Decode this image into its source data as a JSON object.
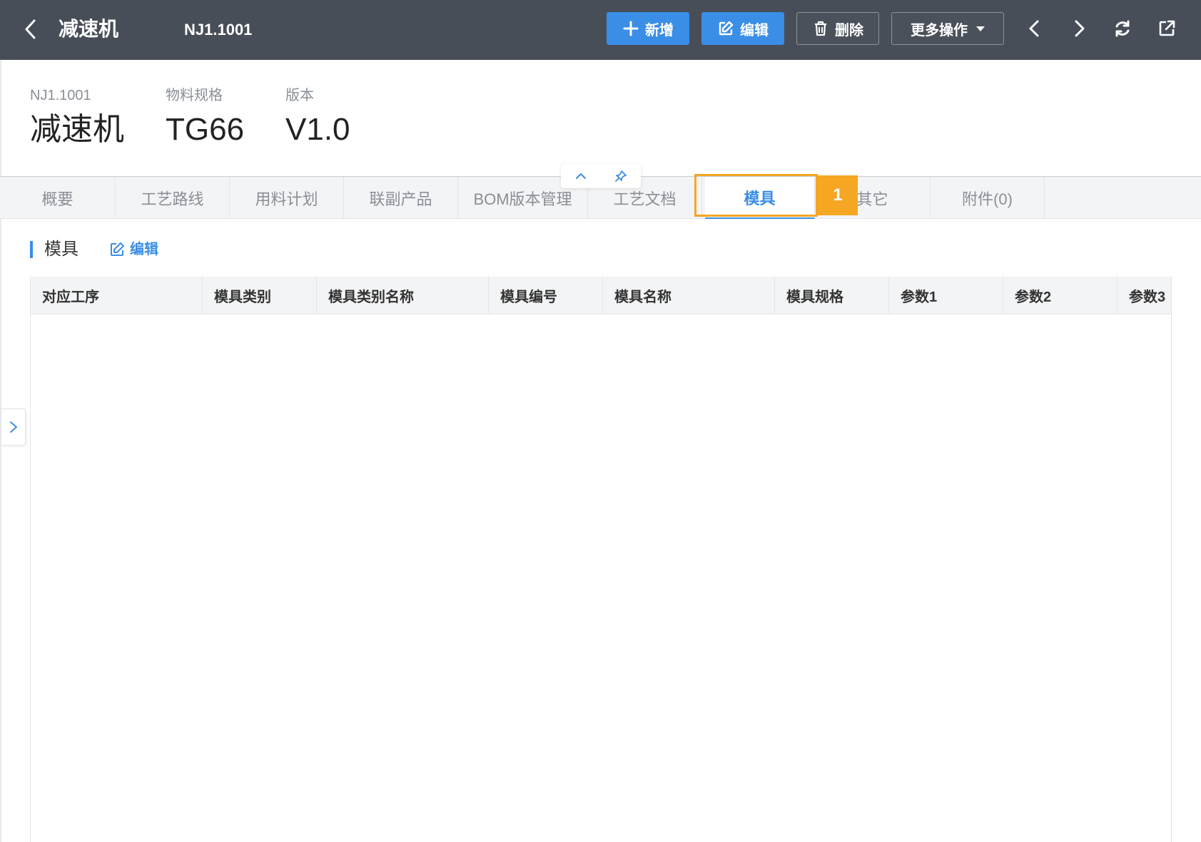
{
  "header": {
    "title": "减速机",
    "code": "NJ1.1001",
    "buttons": {
      "add": "新增",
      "edit": "编辑",
      "delete": "删除",
      "more": "更多操作"
    }
  },
  "info": [
    {
      "label": "NJ1.1001",
      "value": "减速机"
    },
    {
      "label": "物料规格",
      "value": "TG66"
    },
    {
      "label": "版本",
      "value": "V1.0"
    }
  ],
  "tabs": [
    {
      "label": "概要"
    },
    {
      "label": "工艺路线"
    },
    {
      "label": "用料计划"
    },
    {
      "label": "联副产品"
    },
    {
      "label": "BOM版本管理"
    },
    {
      "label": "工艺文档"
    },
    {
      "label": "模具",
      "active": true
    },
    {
      "label": "其它"
    },
    {
      "label": "附件(0)"
    }
  ],
  "callout": {
    "step": "1",
    "color": "#f5a623"
  },
  "section": {
    "title": "模具",
    "edit_label": "编辑"
  },
  "table": {
    "columns": [
      "对应工序",
      "模具类别",
      "模具类别名称",
      "模具编号",
      "模具名称",
      "模具规格",
      "参数1",
      "参数2",
      "参数3"
    ],
    "rows": []
  },
  "colors": {
    "topbar": "#474e57",
    "primary": "#3a8ee6",
    "accent": "#f5a623"
  }
}
